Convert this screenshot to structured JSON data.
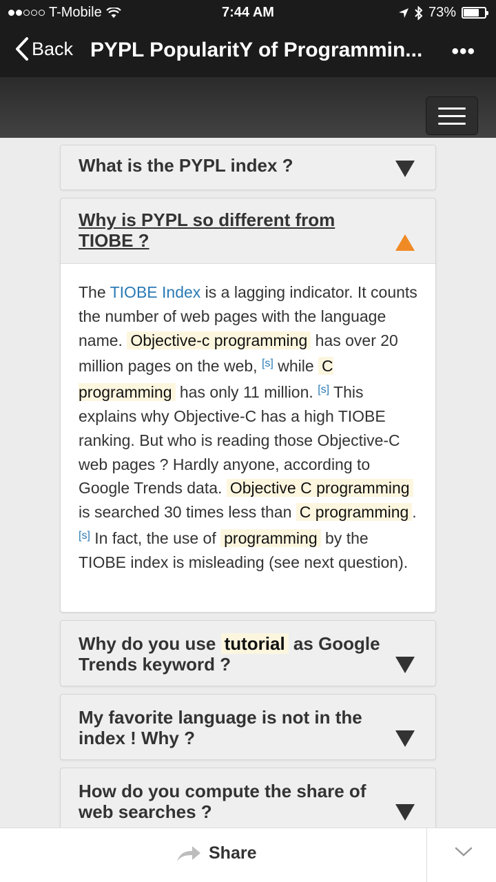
{
  "status": {
    "carrier": "T-Mobile",
    "time": "7:44 AM",
    "battery": "73%",
    "battery_level": 0.73
  },
  "nav": {
    "back_label": "Back",
    "title": "PYPL PopularitY of Programmin...",
    "more": "•••"
  },
  "faqs": [
    {
      "question": "What is the PYPL index ?"
    },
    {
      "question": "Why is PYPL so different from TIOBE ?"
    },
    {
      "q3_pre": "Why do you use",
      "q3_hl": "tutorial",
      "q3_post": "as Google Trends keyword ?"
    },
    {
      "question": "My favorite language is not in the index ! Why ?"
    },
    {
      "question": "How do you compute the share of web searches ?"
    }
  ],
  "answer": {
    "t1": "The ",
    "link": "TIOBE Index",
    "t2": " is a lagging indicator. It counts the number of web pages with the language name. ",
    "hl1": "Objective-c programming",
    "t3": " has over 20 million pages on the web, ",
    "cite": "[s]",
    "t4": " while ",
    "hl2": "C programming",
    "t5": " has only 11 million. ",
    "t6": " This explains why Objective-C has a high TIOBE ranking. But who is reading those Objective-C web pages ? Hardly anyone, according to Google Trends data. ",
    "hl3": "Objective C programming",
    "t7": " is searched 30 times less than ",
    "hl4": "C programming",
    "t8": ". ",
    "t9": " In fact, the use of ",
    "hl5": "programming",
    "t10": " by the TIOBE index is misleading (see next question)."
  },
  "share": {
    "label": "Share"
  }
}
